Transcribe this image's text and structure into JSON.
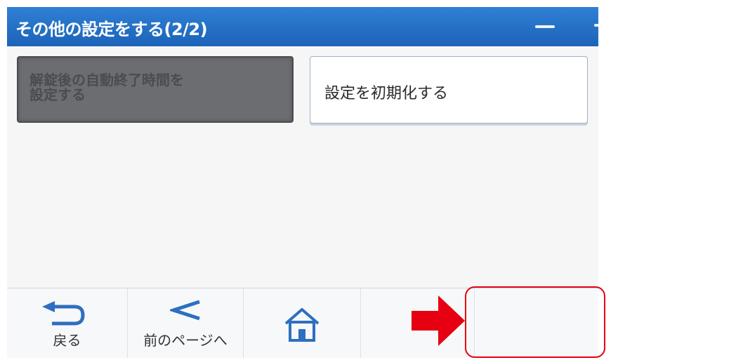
{
  "header": {
    "title": "その他の設定をする(2/2)"
  },
  "buttons": {
    "auto_logout_label": "解錠後の自動終了時間を\n設定する",
    "reset_label": "設定を初期化する"
  },
  "footer": {
    "back_label": "戻る",
    "prev_page_label": "前のページへ",
    "home_icon": "home-icon",
    "back_icon": "return-arrow-icon",
    "prev_icon": "chevron-left-icon"
  },
  "annotation": {
    "highlight_color": "#e60012",
    "arrow_icon": "red-right-arrow-icon"
  },
  "colors": {
    "title_bar": "#1c63b9",
    "disabled_button": "#6b6d70"
  }
}
